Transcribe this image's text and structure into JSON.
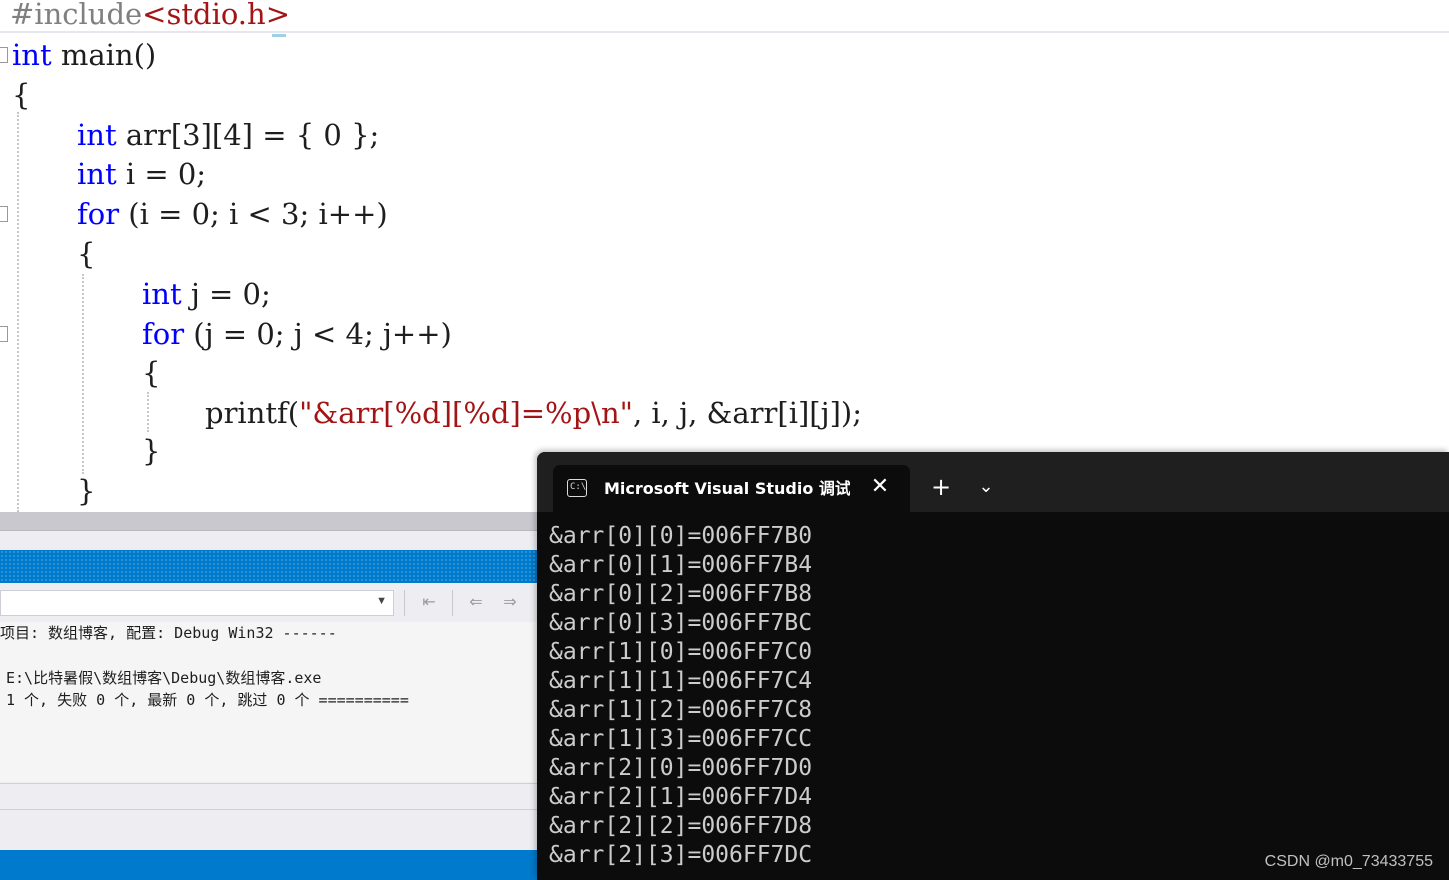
{
  "editor": {
    "include": {
      "directive": "#include",
      "header": "<stdio.h>"
    },
    "lines": {
      "main_kw": "int",
      "main_rest": " main()",
      "open_brace_1": "{",
      "arr_kw": "int",
      "arr_rest": " arr[3][4] = { 0 };",
      "i_kw": "int",
      "i_rest": " i = 0;",
      "for1_kw": "for",
      "for1_rest": " (i = 0; i < 3; i++)",
      "open_brace_2": "{",
      "j_kw": "int",
      "j_rest": " j = 0;",
      "for2_kw": "for",
      "for2_rest": " (j = 0; j < 4; j++)",
      "open_brace_3": "{",
      "printf_fn": "printf(",
      "printf_str": "\"&arr[%d][%d]=%p\\n\"",
      "printf_rest": ", i, j, &arr[i][j]);",
      "close_brace_3": "}",
      "close_brace_2": "}"
    }
  },
  "output_panel": {
    "line1": "项目: 数组博客, 配置: Debug Win32 ------",
    "line2": "E:\\比特暑假\\数组博客\\Debug\\数组博客.exe",
    "line3": "1 个, 失败 0 个, 最新 0 个, 跳过 0 个 =========="
  },
  "terminal": {
    "tab_title": "Microsoft Visual Studio 调试控制台",
    "close_glyph": "✕",
    "new_tab_glyph": "+",
    "dropdown_glyph": "⌄",
    "lines": [
      "&arr[0][0]=006FF7B0",
      "&arr[0][1]=006FF7B4",
      "&arr[0][2]=006FF7B8",
      "&arr[0][3]=006FF7BC",
      "&arr[1][0]=006FF7C0",
      "&arr[1][1]=006FF7C4",
      "&arr[1][2]=006FF7C8",
      "&arr[1][3]=006FF7CC",
      "&arr[2][0]=006FF7D0",
      "&arr[2][1]=006FF7D4",
      "&arr[2][2]=006FF7D8",
      "&arr[2][3]=006FF7DC"
    ]
  },
  "watermark": "CSDN @m0_73433755",
  "colors": {
    "keyword": "#0000ff",
    "string": "#a31515",
    "preprocessor": "#808080",
    "vs_blue": "#007acc",
    "terminal_bg": "#0c0c0c"
  }
}
